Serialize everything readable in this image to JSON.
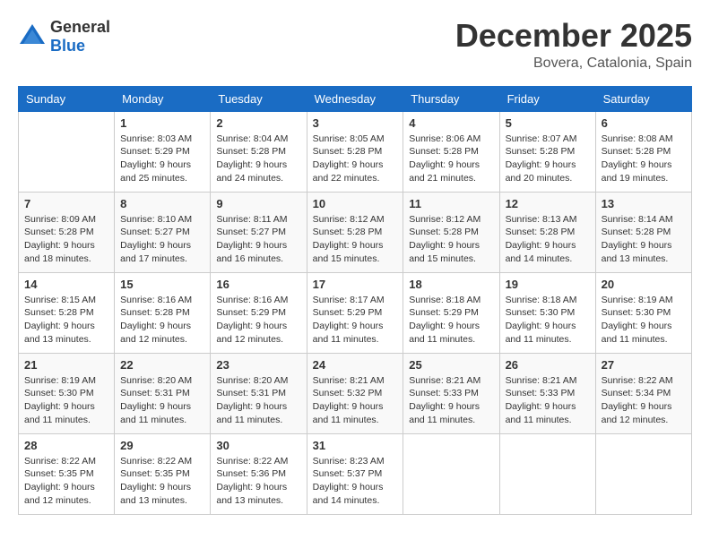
{
  "logo": {
    "general": "General",
    "blue": "Blue"
  },
  "header": {
    "month": "December 2025",
    "location": "Bovera, Catalonia, Spain"
  },
  "weekdays": [
    "Sunday",
    "Monday",
    "Tuesday",
    "Wednesday",
    "Thursday",
    "Friday",
    "Saturday"
  ],
  "weeks": [
    [
      {
        "day": "",
        "info": ""
      },
      {
        "day": "1",
        "info": "Sunrise: 8:03 AM\nSunset: 5:29 PM\nDaylight: 9 hours\nand 25 minutes."
      },
      {
        "day": "2",
        "info": "Sunrise: 8:04 AM\nSunset: 5:28 PM\nDaylight: 9 hours\nand 24 minutes."
      },
      {
        "day": "3",
        "info": "Sunrise: 8:05 AM\nSunset: 5:28 PM\nDaylight: 9 hours\nand 22 minutes."
      },
      {
        "day": "4",
        "info": "Sunrise: 8:06 AM\nSunset: 5:28 PM\nDaylight: 9 hours\nand 21 minutes."
      },
      {
        "day": "5",
        "info": "Sunrise: 8:07 AM\nSunset: 5:28 PM\nDaylight: 9 hours\nand 20 minutes."
      },
      {
        "day": "6",
        "info": "Sunrise: 8:08 AM\nSunset: 5:28 PM\nDaylight: 9 hours\nand 19 minutes."
      }
    ],
    [
      {
        "day": "7",
        "info": "Sunrise: 8:09 AM\nSunset: 5:28 PM\nDaylight: 9 hours\nand 18 minutes."
      },
      {
        "day": "8",
        "info": "Sunrise: 8:10 AM\nSunset: 5:27 PM\nDaylight: 9 hours\nand 17 minutes."
      },
      {
        "day": "9",
        "info": "Sunrise: 8:11 AM\nSunset: 5:27 PM\nDaylight: 9 hours\nand 16 minutes."
      },
      {
        "day": "10",
        "info": "Sunrise: 8:12 AM\nSunset: 5:28 PM\nDaylight: 9 hours\nand 15 minutes."
      },
      {
        "day": "11",
        "info": "Sunrise: 8:12 AM\nSunset: 5:28 PM\nDaylight: 9 hours\nand 15 minutes."
      },
      {
        "day": "12",
        "info": "Sunrise: 8:13 AM\nSunset: 5:28 PM\nDaylight: 9 hours\nand 14 minutes."
      },
      {
        "day": "13",
        "info": "Sunrise: 8:14 AM\nSunset: 5:28 PM\nDaylight: 9 hours\nand 13 minutes."
      }
    ],
    [
      {
        "day": "14",
        "info": "Sunrise: 8:15 AM\nSunset: 5:28 PM\nDaylight: 9 hours\nand 13 minutes."
      },
      {
        "day": "15",
        "info": "Sunrise: 8:16 AM\nSunset: 5:28 PM\nDaylight: 9 hours\nand 12 minutes."
      },
      {
        "day": "16",
        "info": "Sunrise: 8:16 AM\nSunset: 5:29 PM\nDaylight: 9 hours\nand 12 minutes."
      },
      {
        "day": "17",
        "info": "Sunrise: 8:17 AM\nSunset: 5:29 PM\nDaylight: 9 hours\nand 11 minutes."
      },
      {
        "day": "18",
        "info": "Sunrise: 8:18 AM\nSunset: 5:29 PM\nDaylight: 9 hours\nand 11 minutes."
      },
      {
        "day": "19",
        "info": "Sunrise: 8:18 AM\nSunset: 5:30 PM\nDaylight: 9 hours\nand 11 minutes."
      },
      {
        "day": "20",
        "info": "Sunrise: 8:19 AM\nSunset: 5:30 PM\nDaylight: 9 hours\nand 11 minutes."
      }
    ],
    [
      {
        "day": "21",
        "info": "Sunrise: 8:19 AM\nSunset: 5:30 PM\nDaylight: 9 hours\nand 11 minutes."
      },
      {
        "day": "22",
        "info": "Sunrise: 8:20 AM\nSunset: 5:31 PM\nDaylight: 9 hours\nand 11 minutes."
      },
      {
        "day": "23",
        "info": "Sunrise: 8:20 AM\nSunset: 5:31 PM\nDaylight: 9 hours\nand 11 minutes."
      },
      {
        "day": "24",
        "info": "Sunrise: 8:21 AM\nSunset: 5:32 PM\nDaylight: 9 hours\nand 11 minutes."
      },
      {
        "day": "25",
        "info": "Sunrise: 8:21 AM\nSunset: 5:33 PM\nDaylight: 9 hours\nand 11 minutes."
      },
      {
        "day": "26",
        "info": "Sunrise: 8:21 AM\nSunset: 5:33 PM\nDaylight: 9 hours\nand 11 minutes."
      },
      {
        "day": "27",
        "info": "Sunrise: 8:22 AM\nSunset: 5:34 PM\nDaylight: 9 hours\nand 12 minutes."
      }
    ],
    [
      {
        "day": "28",
        "info": "Sunrise: 8:22 AM\nSunset: 5:35 PM\nDaylight: 9 hours\nand 12 minutes."
      },
      {
        "day": "29",
        "info": "Sunrise: 8:22 AM\nSunset: 5:35 PM\nDaylight: 9 hours\nand 13 minutes."
      },
      {
        "day": "30",
        "info": "Sunrise: 8:22 AM\nSunset: 5:36 PM\nDaylight: 9 hours\nand 13 minutes."
      },
      {
        "day": "31",
        "info": "Sunrise: 8:23 AM\nSunset: 5:37 PM\nDaylight: 9 hours\nand 14 minutes."
      },
      {
        "day": "",
        "info": ""
      },
      {
        "day": "",
        "info": ""
      },
      {
        "day": "",
        "info": ""
      }
    ]
  ]
}
